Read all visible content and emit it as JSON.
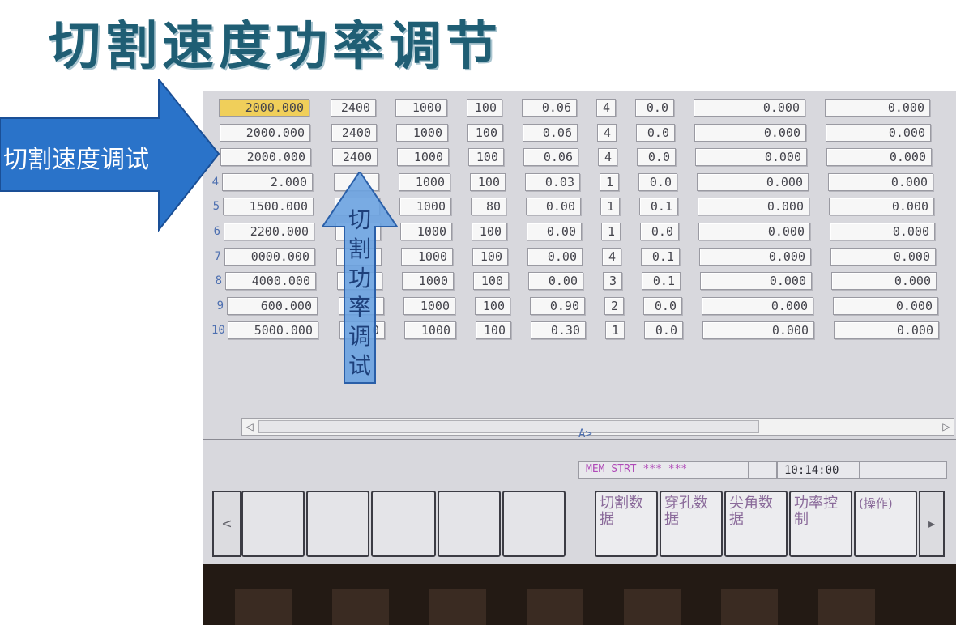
{
  "slide": {
    "title": "切割速度功率调节"
  },
  "annotations": {
    "speed_label": "切割速度调试",
    "power_label": [
      "切",
      "割",
      "功",
      "率",
      "调",
      "试"
    ]
  },
  "table": {
    "rows": [
      {
        "num": "",
        "c1": "2000.000",
        "c2": "2400",
        "c3": "1000",
        "c4": "100",
        "c5": "0.06",
        "c6": "4",
        "c7": "0.0",
        "c8": "0.000",
        "c9": "0.000"
      },
      {
        "num": "",
        "c1": "2000.000",
        "c2": "2400",
        "c3": "1000",
        "c4": "100",
        "c5": "0.06",
        "c6": "4",
        "c7": "0.0",
        "c8": "0.000",
        "c9": "0.000"
      },
      {
        "num": "",
        "c1": "2000.000",
        "c2": "2400",
        "c3": "1000",
        "c4": "100",
        "c5": "0.06",
        "c6": "4",
        "c7": "0.0",
        "c8": "0.000",
        "c9": "0.000"
      },
      {
        "num": "4",
        "c1": "2.000",
        "c2": "",
        "c3": "1000",
        "c4": "100",
        "c5": "0.03",
        "c6": "1",
        "c7": "0.0",
        "c8": "0.000",
        "c9": "0.000"
      },
      {
        "num": "5",
        "c1": "1500.000",
        "c2": "",
        "c3": "1000",
        "c4": "80",
        "c5": "0.00",
        "c6": "1",
        "c7": "0.1",
        "c8": "0.000",
        "c9": "0.000"
      },
      {
        "num": "6",
        "c1": "2200.000",
        "c2": "",
        "c3": "1000",
        "c4": "100",
        "c5": "0.00",
        "c6": "1",
        "c7": "0.0",
        "c8": "0.000",
        "c9": "0.000"
      },
      {
        "num": "7",
        "c1": "0000.000",
        "c2": "",
        "c3": "1000",
        "c4": "100",
        "c5": "0.00",
        "c6": "4",
        "c7": "0.1",
        "c8": "0.000",
        "c9": "0.000"
      },
      {
        "num": "8",
        "c1": "4000.000",
        "c2": "",
        "c3": "1000",
        "c4": "100",
        "c5": "0.00",
        "c6": "3",
        "c7": "0.1",
        "c8": "0.000",
        "c9": "0.000"
      },
      {
        "num": "9",
        "c1": "600.000",
        "c2": "",
        "c3": "1000",
        "c4": "100",
        "c5": "0.90",
        "c6": "2",
        "c7": "0.0",
        "c8": "0.000",
        "c9": "0.000"
      },
      {
        "num": "10",
        "c1": "5000.000",
        "c2": "0",
        "c3": "1000",
        "c4": "100",
        "c5": "0.30",
        "c6": "1",
        "c7": "0.0",
        "c8": "0.000",
        "c9": "0.000"
      }
    ]
  },
  "command_prompt": "A>_",
  "status": {
    "mode": "MEM  STRT  ***  ***",
    "time": "10:14:00"
  },
  "softkeys": {
    "left_nav": "<",
    "right_nav": "▸",
    "cutting_data": "切割数据",
    "pierce_data": "穿孔数据",
    "corner_data": "尖角数据",
    "power_control": "功率控制",
    "operate": "(操作)"
  },
  "colors": {
    "title": "#1f5e74",
    "arrow_fill": "#2a73c9",
    "screen_bg": "#d8d8dd",
    "selected_cell": "#f0cf5a",
    "mode_text": "#b04ab8"
  }
}
